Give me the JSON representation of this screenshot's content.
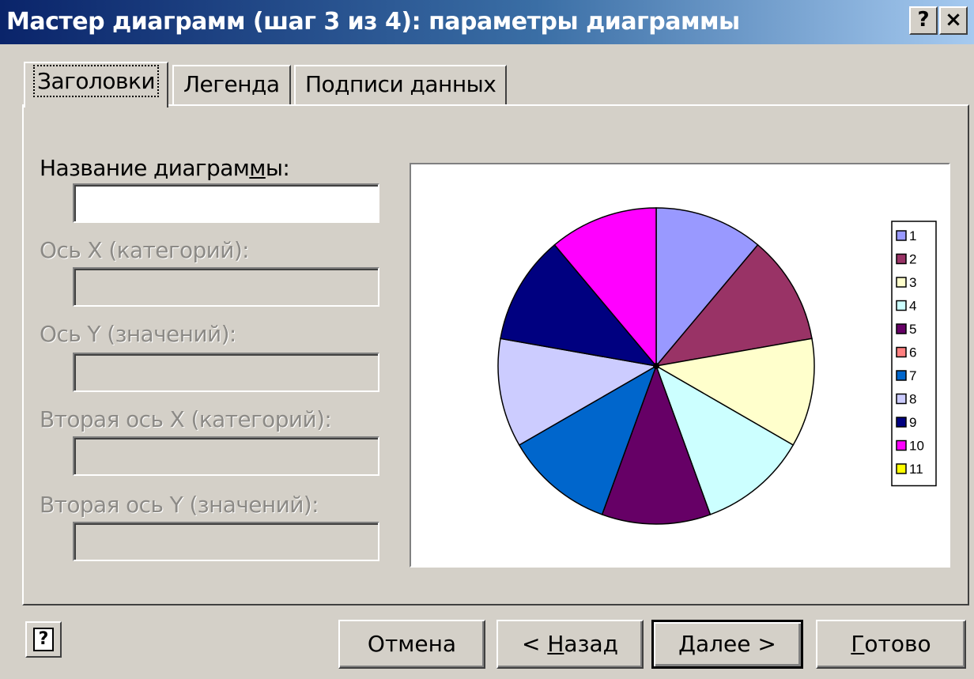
{
  "window": {
    "title": "Мастер диаграмм (шаг 3 из 4): параметры диаграммы",
    "help_glyph": "?",
    "close_glyph": "×"
  },
  "tabs": [
    {
      "label": "Заголовки",
      "active": true
    },
    {
      "label": "Легенда",
      "active": false
    },
    {
      "label": "Подписи данных",
      "active": false
    }
  ],
  "fields": {
    "chart_title": {
      "label_pre": "Название диаграм",
      "label_u": "м",
      "label_post": "ы:",
      "value": ""
    },
    "x_axis": {
      "label": "Ось X (категорий):",
      "value": ""
    },
    "y_axis": {
      "label": "Ось Y (значений):",
      "value": ""
    },
    "x2_axis": {
      "label": "Вторая ось X (категорий):",
      "value": ""
    },
    "y2_axis": {
      "label": "Вторая ось Y (значений):",
      "value": ""
    }
  },
  "chart_data": {
    "type": "pie",
    "categories": [
      "1",
      "2",
      "3",
      "4",
      "5",
      "6",
      "7",
      "8",
      "9",
      "10",
      "11"
    ],
    "visible_slices": [
      {
        "category": "1",
        "value": 1,
        "color": "#9999ff"
      },
      {
        "category": "2",
        "value": 1,
        "color": "#993366"
      },
      {
        "category": "3",
        "value": 1,
        "color": "#ffffcc"
      },
      {
        "category": "4",
        "value": 1,
        "color": "#ccffff"
      },
      {
        "category": "5",
        "value": 1,
        "color": "#660066"
      },
      {
        "category": "7",
        "value": 1,
        "color": "#0066cc"
      },
      {
        "category": "8",
        "value": 1,
        "color": "#ccccff"
      },
      {
        "category": "9",
        "value": 1,
        "color": "#000080"
      },
      {
        "category": "10",
        "value": 1,
        "color": "#ff00ff"
      }
    ],
    "legend": [
      {
        "label": "1",
        "color": "#9999ff"
      },
      {
        "label": "2",
        "color": "#993366"
      },
      {
        "label": "3",
        "color": "#ffffcc"
      },
      {
        "label": "4",
        "color": "#ccffff"
      },
      {
        "label": "5",
        "color": "#660066"
      },
      {
        "label": "6",
        "color": "#ff8080"
      },
      {
        "label": "7",
        "color": "#0066cc"
      },
      {
        "label": "8",
        "color": "#ccccff"
      },
      {
        "label": "9",
        "color": "#000080"
      },
      {
        "label": "10",
        "color": "#ff00ff"
      },
      {
        "label": "11",
        "color": "#ffff00"
      }
    ],
    "legend_position": "right",
    "title": ""
  },
  "buttons": {
    "cancel": "Отмена",
    "back_pre": "< ",
    "back_u": "Н",
    "back_post": "азад",
    "next_u": "Д",
    "next_post": "алее >",
    "finish_u": "Г",
    "finish_post": "отово"
  }
}
